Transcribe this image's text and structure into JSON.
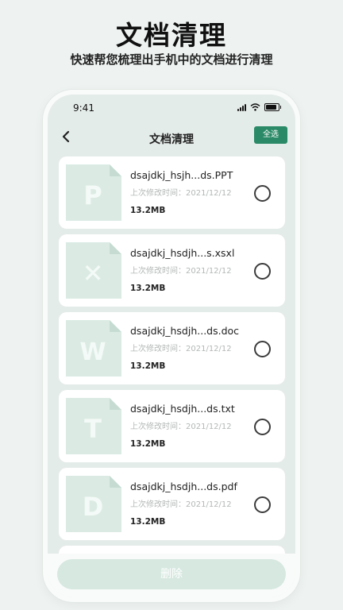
{
  "promo": {
    "title": "文档清理",
    "subtitle": "快速帮您梳理出手机中的文档进行清理"
  },
  "status_bar": {
    "time": "9:41",
    "icons": [
      "signal-icon",
      "wifi-icon",
      "battery-icon"
    ]
  },
  "nav": {
    "back_icon": "chevron-left-icon",
    "title": "文档清理",
    "select_all_label": "全选"
  },
  "files": [
    {
      "letter": "P",
      "name": "dsajdkj_hsjh...ds.PPT",
      "meta": "上次修改时间：2021/12/12",
      "size": "13.2MB",
      "selected": false
    },
    {
      "letter": "✕",
      "name": "dsajdkj_hsdjh...s.xsxl",
      "meta": "上次修改时间：2021/12/12",
      "size": "13.2MB",
      "selected": false
    },
    {
      "letter": "W",
      "name": "dsajdkj_hsdjh...ds.doc",
      "meta": "上次修改时间：2021/12/12",
      "size": "13.2MB",
      "selected": false
    },
    {
      "letter": "T",
      "name": "dsajdkj_hsdjh...ds.txt",
      "meta": "上次修改时间：2021/12/12",
      "size": "13.2MB",
      "selected": false
    },
    {
      "letter": "D",
      "name": "dsajdkj_hsdjh...ds.pdf",
      "meta": "上次修改时间：2021/12/12",
      "size": "13.2MB",
      "selected": false
    }
  ],
  "actions": {
    "delete_label": "删除"
  },
  "colors": {
    "accent": "#2a8a67",
    "icon_fill": "#dbebe4",
    "icon_letter": "#f4faf7",
    "disabled_button": "#d6e8e0"
  }
}
